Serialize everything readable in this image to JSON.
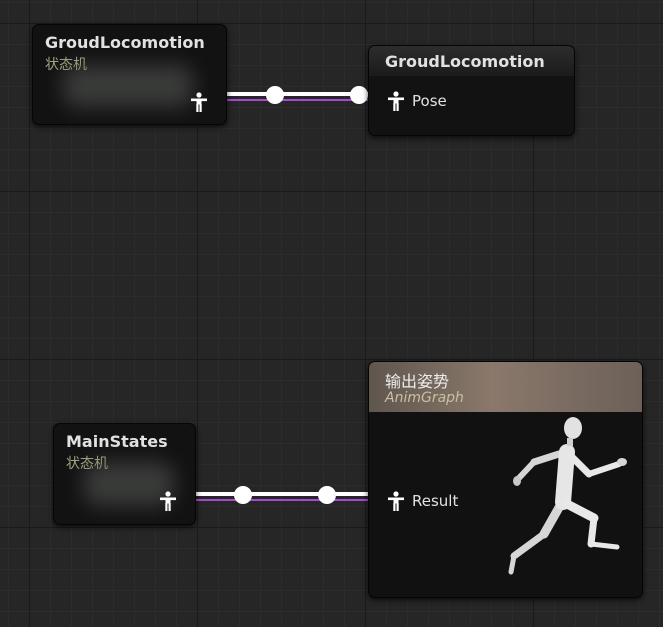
{
  "nodes": {
    "sm_ground": {
      "title": "GroudLocomotion",
      "subtitle": "状态机"
    },
    "pose_ground": {
      "title": "GroudLocomotion",
      "pin_label": "Pose"
    },
    "sm_main": {
      "title": "MainStates",
      "subtitle": "状态机"
    },
    "output_pose": {
      "title": "输出姿势",
      "subtitle": "AnimGraph",
      "pin_label": "Result"
    }
  },
  "colors": {
    "wire": "#ffffff",
    "wire_secondary": "#a64ad6",
    "output_header": "#8a786b",
    "subtitle": "#a6a67e"
  }
}
